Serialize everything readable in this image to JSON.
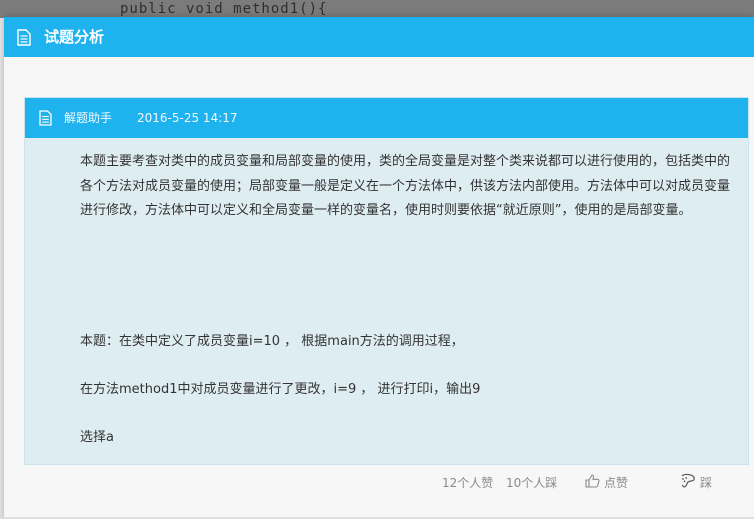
{
  "background": {
    "code_text": "public void method1(){"
  },
  "dialog": {
    "title": "试题分析",
    "title_icon": "document-icon"
  },
  "card": {
    "author": "解题助手",
    "date": "2016-5-25 14:17",
    "paragraphs": [
      "本题主要考查对类中的成员变量和局部变量的使用，类的全局变量是对整个类来说都可以进行使用的，包括类中的各个方法对成员变量的使用；局部变量一般是定义在一个方法体中，供该方法内部使用。方法体中可以对成员变量进行修改，方法体中可以定义和全局变量一样的变量名，使用时则要依据“就近原则”，使用的是局部变量。",
      "本题：在类中定义了成员变量i=10 ， 根据main方法的调用过程，",
      "在方法method1中对成员变量进行了更改，i=9 ， 进行打印i，输出9",
      "选择a"
    ]
  },
  "footer": {
    "likes_text": "12个人赞",
    "dislikes_text": "10个人踩",
    "like_label": "点赞",
    "dislike_label": "踩"
  },
  "colors": {
    "accent": "#1eb2ef",
    "card_bg": "#deedf2",
    "text": "#333333"
  }
}
